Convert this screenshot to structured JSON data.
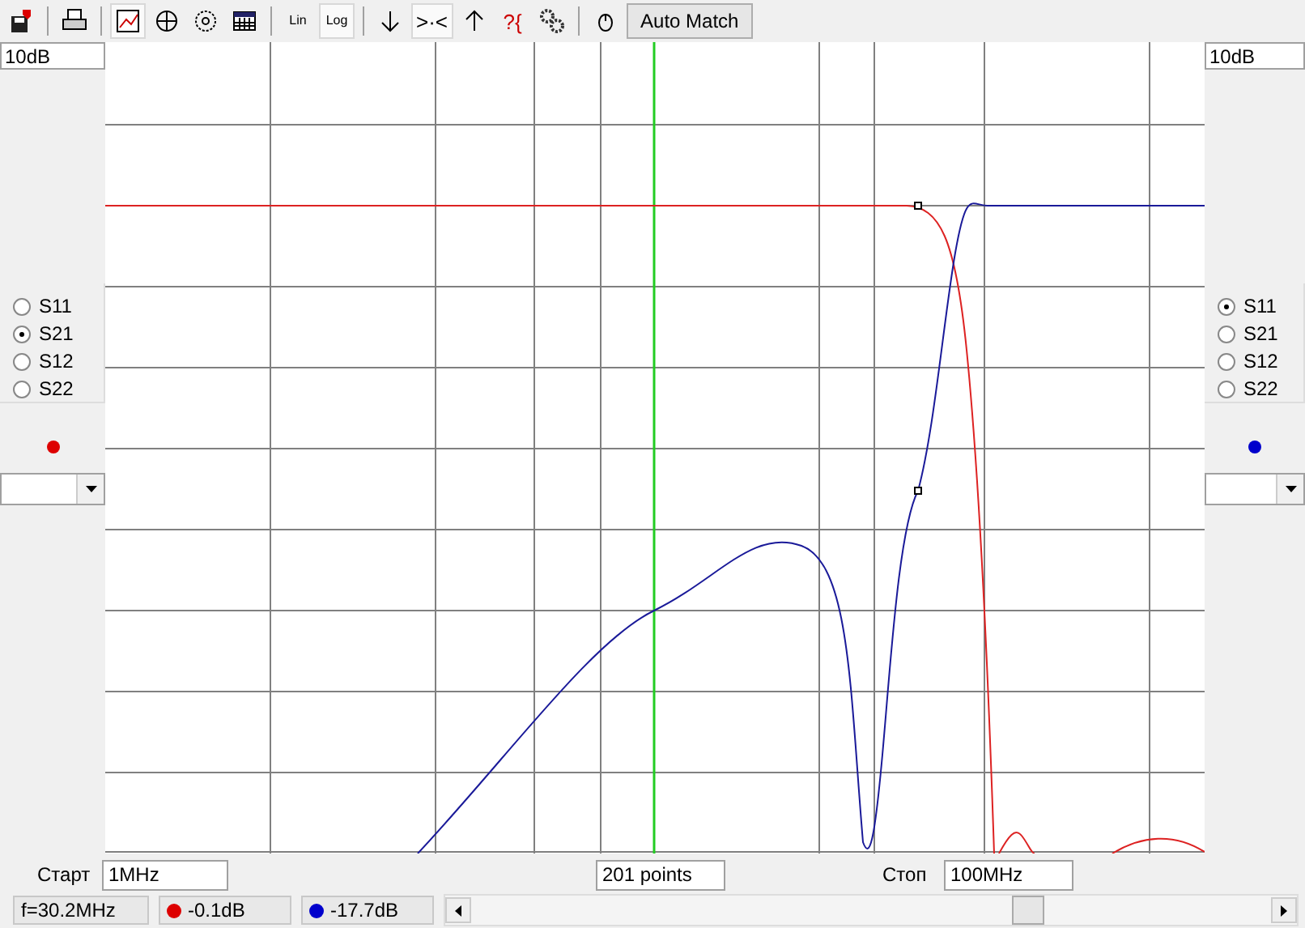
{
  "toolbar": [
    {
      "kind": "save",
      "selected": false
    },
    {
      "kind": "sep"
    },
    {
      "kind": "print",
      "selected": false
    },
    {
      "kind": "sep"
    },
    {
      "kind": "chart",
      "selected": true
    },
    {
      "kind": "polar",
      "selected": false
    },
    {
      "kind": "smith",
      "selected": false
    },
    {
      "kind": "table",
      "selected": false
    },
    {
      "kind": "sep"
    },
    {
      "kind": "text",
      "label": "Lin",
      "selected": false
    },
    {
      "kind": "text",
      "label": "Log",
      "selected": true
    },
    {
      "kind": "sep"
    },
    {
      "kind": "down",
      "selected": false
    },
    {
      "kind": "glyph",
      "label": ">·<",
      "selected": true
    },
    {
      "kind": "up",
      "selected": false
    },
    {
      "kind": "help",
      "label": "?{",
      "selected": false
    },
    {
      "kind": "gears",
      "selected": false
    },
    {
      "kind": "sep"
    },
    {
      "kind": "mouse",
      "selected": false
    },
    {
      "kind": "button",
      "label": "Auto Match",
      "selected": false
    }
  ],
  "left_panel": {
    "scale": "10dB",
    "params": [
      {
        "label": "S11",
        "selected": false
      },
      {
        "label": "S21",
        "selected": true
      },
      {
        "label": "S12",
        "selected": false
      },
      {
        "label": "S22",
        "selected": false
      }
    ],
    "color": "#dd0000"
  },
  "right_panel": {
    "scale": "10dB",
    "params": [
      {
        "label": "S11",
        "selected": true
      },
      {
        "label": "S21",
        "selected": false
      },
      {
        "label": "S12",
        "selected": false
      },
      {
        "label": "S22",
        "selected": false
      }
    ],
    "color": "#0000cc"
  },
  "sweep": {
    "start_label": "Старт",
    "start": "1MHz",
    "points": "201 points",
    "stop_label": "Стоп",
    "stop": "100MHz"
  },
  "status_bar": {
    "frequency": "f=30.2MHz",
    "readings": [
      {
        "value": "-0.1dB",
        "color": "#dd0000"
      },
      {
        "value": "-17.7dB",
        "color": "#0000cc"
      }
    ]
  }
}
